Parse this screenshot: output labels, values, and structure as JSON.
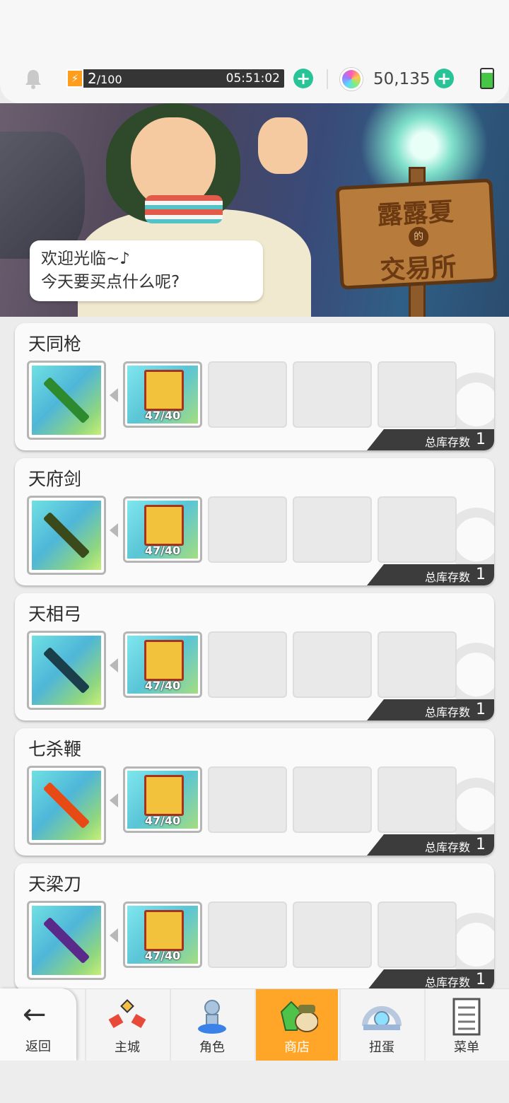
{
  "topbar": {
    "energy": {
      "current": "2",
      "max": "/100",
      "timer": "05:51:02"
    },
    "gems": "50,135",
    "icons": [
      "bell-icon",
      "lightning-icon",
      "plus-icon",
      "rainbow-orb-icon",
      "battery-icon"
    ]
  },
  "banner": {
    "sign_line1": "露露夏",
    "sign_de": "的",
    "sign_line2": "交易所",
    "greeting_line1": "欢迎光临~♪",
    "greeting_line2": "今天要买点什么呢?"
  },
  "shop_items": [
    {
      "name": "天同枪",
      "material_count": "47/40",
      "stock_label": "总库存数",
      "stock": "1",
      "weapon_color": "#2e8a2e"
    },
    {
      "name": "天府剑",
      "material_count": "47/40",
      "stock_label": "总库存数",
      "stock": "1",
      "weapon_color": "#3a4a1a"
    },
    {
      "name": "天相弓",
      "material_count": "47/40",
      "stock_label": "总库存数",
      "stock": "1",
      "weapon_color": "#1a3f4a"
    },
    {
      "name": "七杀鞭",
      "material_count": "47/40",
      "stock_label": "总库存数",
      "stock": "1",
      "weapon_color": "#e84a16"
    },
    {
      "name": "天梁刀",
      "material_count": "47/40",
      "stock_label": "总库存数",
      "stock": "1",
      "weapon_color": "#5a2a8a"
    }
  ],
  "tabbar": {
    "back": "返回",
    "tabs": [
      {
        "label": "主城",
        "icon": "castle-icon",
        "color": "#e84a3a"
      },
      {
        "label": "角色",
        "icon": "character-icon",
        "color": "#5aa0e8"
      },
      {
        "label": "商店",
        "icon": "shop-icon",
        "color": "#4fc24a",
        "active": true
      },
      {
        "label": "扭蛋",
        "icon": "gacha-icon",
        "color": "#9ab6d8"
      },
      {
        "label": "菜单",
        "icon": "menu-icon",
        "color": "#7a7a7a"
      }
    ]
  }
}
